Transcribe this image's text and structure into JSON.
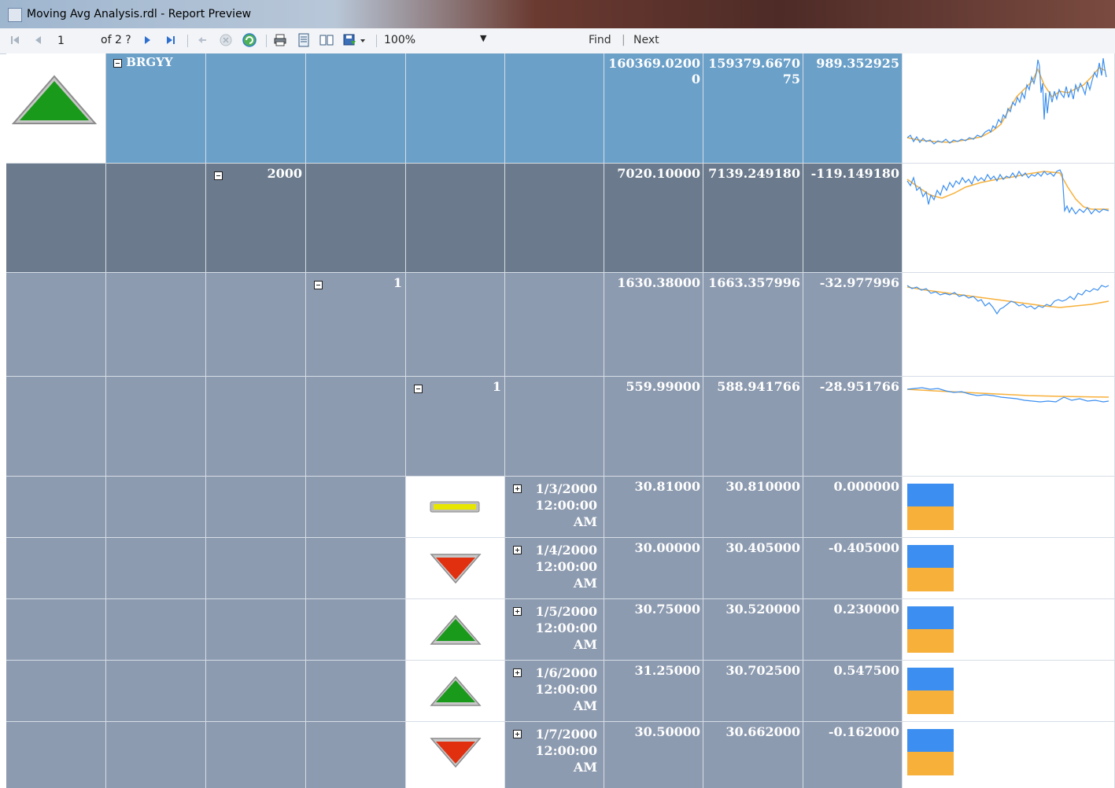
{
  "window": {
    "title": "Moving Avg Analysis.rdl - Report Preview"
  },
  "toolbar": {
    "page_current": "1",
    "page_of": "of 2 ?",
    "zoom": "100%",
    "find": "Find",
    "separator": "|",
    "next": "Next"
  },
  "colors": {
    "level0": "#6ba0c9",
    "level1": "#6b7b8d",
    "level2": "#8d9bb0",
    "up": "#1a9a1a",
    "down": "#e03010",
    "flat": "#e6e600",
    "series_actual": "#3c8ff0",
    "series_avg": "#f7b03a"
  },
  "report": {
    "group_rows": [
      {
        "label": "BRGYY",
        "value": "160369.02000",
        "avg": "159379.667075",
        "diff": "989.352925",
        "indicator": "up"
      },
      {
        "label": "2000",
        "value": "7020.10000",
        "avg": "7139.249180",
        "diff": "-119.149180"
      },
      {
        "label": "1",
        "value": "1630.38000",
        "avg": "1663.357996",
        "diff": "-32.977996"
      },
      {
        "label": "1",
        "value": "559.99000",
        "avg": "588.941766",
        "diff": "-28.951766"
      }
    ],
    "detail_rows": [
      {
        "date": "1/3/2000",
        "time": "12:00:00",
        "ampm": "AM",
        "value": "30.81000",
        "avg": "30.810000",
        "diff": "0.000000",
        "indicator": "flat",
        "bar_actual": 30.81,
        "bar_avg": 30.81
      },
      {
        "date": "1/4/2000",
        "time": "12:00:00",
        "ampm": "AM",
        "value": "30.00000",
        "avg": "30.405000",
        "diff": "-0.405000",
        "indicator": "down",
        "bar_actual": 30.0,
        "bar_avg": 30.405
      },
      {
        "date": "1/5/2000",
        "time": "12:00:00",
        "ampm": "AM",
        "value": "30.75000",
        "avg": "30.520000",
        "diff": "0.230000",
        "indicator": "up",
        "bar_actual": 30.75,
        "bar_avg": 30.52
      },
      {
        "date": "1/6/2000",
        "time": "12:00:00",
        "ampm": "AM",
        "value": "31.25000",
        "avg": "30.702500",
        "diff": "0.547500",
        "indicator": "up",
        "bar_actual": 31.25,
        "bar_avg": 30.7025
      },
      {
        "date": "1/7/2000",
        "time": "12:00:00",
        "ampm": "AM",
        "value": "30.50000",
        "avg": "30.662000",
        "diff": "-0.162000",
        "indicator": "down",
        "bar_actual": 30.5,
        "bar_avg": 30.662
      }
    ]
  }
}
